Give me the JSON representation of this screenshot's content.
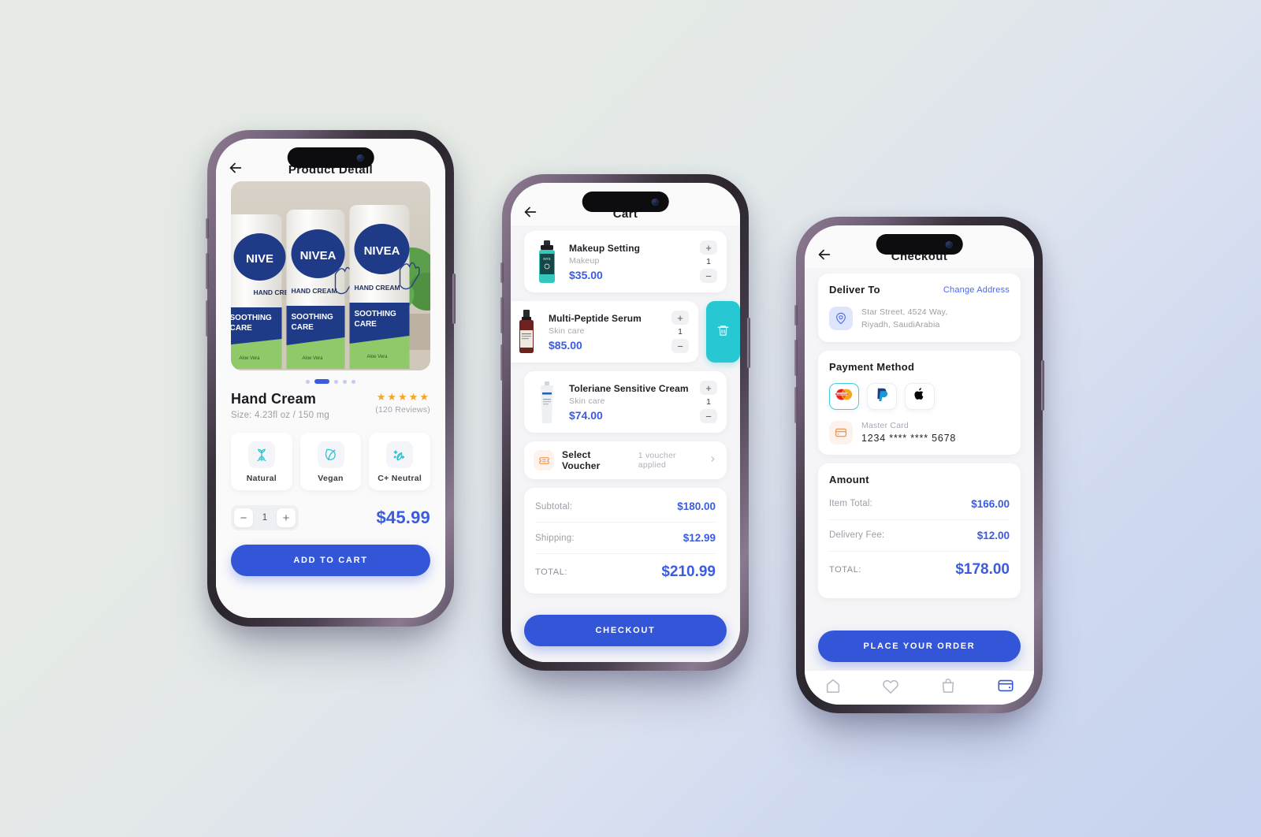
{
  "product_detail": {
    "title": "Product Detail",
    "back_icon": "arrow-left-icon",
    "carousel": {
      "dot_count": 5,
      "active_index": 1
    },
    "hero_image_alt": "NIVEA Soothing Care Hand Cream tubes with aloe vera",
    "name": "Hand Cream",
    "size": "Size: 4.23fl oz / 150 mg",
    "stars": "★★★★★",
    "star_count": 5,
    "reviews": "(120 Reviews)",
    "badges": [
      {
        "label": "Natural",
        "icon": "sprout-icon"
      },
      {
        "label": "Vegan",
        "icon": "leaf-icon"
      },
      {
        "label": "C+ Neutral",
        "icon": "sparkle-plant-icon"
      }
    ],
    "quantity": "1",
    "minus_label": "−",
    "plus_label": "+",
    "price": "$45.99",
    "cta_label": "ADD TO CART"
  },
  "cart": {
    "title": "Cart",
    "back_icon": "arrow-left-icon",
    "items": [
      {
        "name": "Makeup Setting",
        "category": "Makeup",
        "price": "$35.00",
        "qty": "1",
        "swiped": false,
        "thumb": "spray-bottle-teal"
      },
      {
        "name": "Multi-Peptide Serum",
        "category": "Skin care",
        "price": "$85.00",
        "qty": "1",
        "swiped": true,
        "thumb": "dropper-bottle-amber"
      },
      {
        "name": "Toleriane Sensitive Cream",
        "category": "Skin care",
        "price": "$74.00",
        "qty": "1",
        "swiped": false,
        "thumb": "cream-tube-white"
      }
    ],
    "delete_icon": "trash-icon",
    "voucher": {
      "icon": "ticket-icon",
      "label": "Select Voucher",
      "status": "1 voucher applied",
      "chevron": "chevron-right-icon"
    },
    "totals": [
      {
        "label": "Subtotal:",
        "value": "$180.00",
        "grand": false
      },
      {
        "label": "Shipping:",
        "value": "$12.99",
        "grand": false
      },
      {
        "label": "TOTAL:",
        "value": "$210.99",
        "grand": true
      }
    ],
    "cta_label": "CHECKOUT"
  },
  "checkout": {
    "title": "Checkout",
    "back_icon": "arrow-left-icon",
    "deliver": {
      "title": "Deliver To",
      "change_link": "Change Address",
      "pin_icon": "map-pin-icon",
      "address_line1": "Star Street, 4524 Way,",
      "address_line2": "Riyadh, SaudiArabia"
    },
    "payment": {
      "title": "Payment Method",
      "options": [
        {
          "name": "mastercard-icon",
          "selected": true
        },
        {
          "name": "paypal-icon",
          "selected": false
        },
        {
          "name": "apple-pay-icon",
          "selected": false
        }
      ],
      "saved_icon": "credit-card-icon",
      "saved_kind": "Master Card",
      "saved_number": "1234 **** **** 5678"
    },
    "amount": {
      "title": "Amount",
      "rows": [
        {
          "label": "Item Total:",
          "value": "$166.00",
          "grand": false
        },
        {
          "label": "Delivery Fee:",
          "value": "$12.00",
          "grand": false
        },
        {
          "label": "TOTAL:",
          "value": "$178.00",
          "grand": true
        }
      ]
    },
    "cta_label": "PLACE YOUR ORDER",
    "tabs": [
      {
        "name": "home-icon",
        "active": false
      },
      {
        "name": "heart-icon",
        "active": false
      },
      {
        "name": "shopping-bag-icon",
        "active": false
      },
      {
        "name": "credit-card-icon",
        "active": true
      }
    ]
  },
  "colors": {
    "primary_blue": "#3355d8",
    "price_blue": "#3b5ce0",
    "teal": "#27c7d4",
    "star_orange": "#f5a623",
    "bg_start": "#e5eae5",
    "bg_end": "#c6d2ee"
  }
}
